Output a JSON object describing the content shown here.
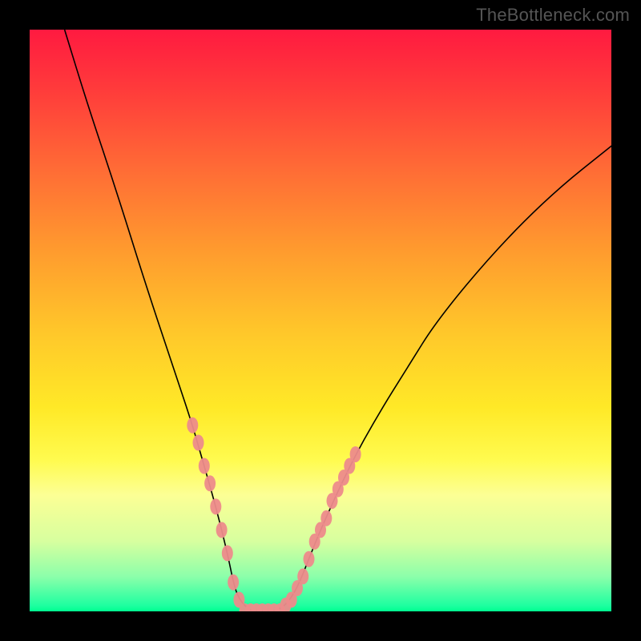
{
  "watermark": "TheBottleneck.com",
  "chart_data": {
    "type": "line",
    "title": "",
    "xlabel": "",
    "ylabel": "",
    "xlim": [
      0,
      100
    ],
    "ylim": [
      0,
      100
    ],
    "grid": false,
    "series": [
      {
        "name": "bottleneck-curve",
        "x": [
          6,
          10,
          15,
          20,
          25,
          28,
          30,
          32,
          34,
          35,
          36,
          38,
          40,
          42,
          44,
          46,
          48,
          50,
          55,
          60,
          65,
          70,
          80,
          90,
          100
        ],
        "y": [
          100,
          87,
          72,
          56,
          41,
          32,
          25,
          18,
          10,
          5,
          2,
          0,
          0,
          0,
          1,
          4,
          9,
          14,
          25,
          34,
          42,
          50,
          62,
          72,
          80
        ],
        "color": "#000000"
      }
    ],
    "curve_minimum_x": 40,
    "highlight_points": {
      "description": "pink dot markers overlaid on lower arms of curve",
      "color": "#ed8b8b",
      "x": [
        28,
        29,
        30,
        31,
        32,
        33,
        34,
        35,
        36,
        37,
        38,
        39,
        40,
        41,
        42,
        43,
        44,
        45,
        46,
        47,
        48,
        49,
        50,
        51,
        52,
        53,
        54,
        55,
        56
      ],
      "y": [
        32,
        29,
        25,
        22,
        18,
        14,
        10,
        5,
        2,
        0,
        0,
        0,
        0,
        0,
        0,
        0,
        1,
        2,
        4,
        6,
        9,
        12,
        14,
        16,
        19,
        21,
        23,
        25,
        27
      ]
    },
    "background_gradient": {
      "type": "vertical",
      "stops": [
        {
          "pos": 0,
          "color": "#ff1a40"
        },
        {
          "pos": 25,
          "color": "#ff6f35"
        },
        {
          "pos": 52,
          "color": "#ffc72a"
        },
        {
          "pos": 74,
          "color": "#fffb4f"
        },
        {
          "pos": 94,
          "color": "#8cffaa"
        },
        {
          "pos": 100,
          "color": "#00ff90"
        }
      ]
    }
  }
}
